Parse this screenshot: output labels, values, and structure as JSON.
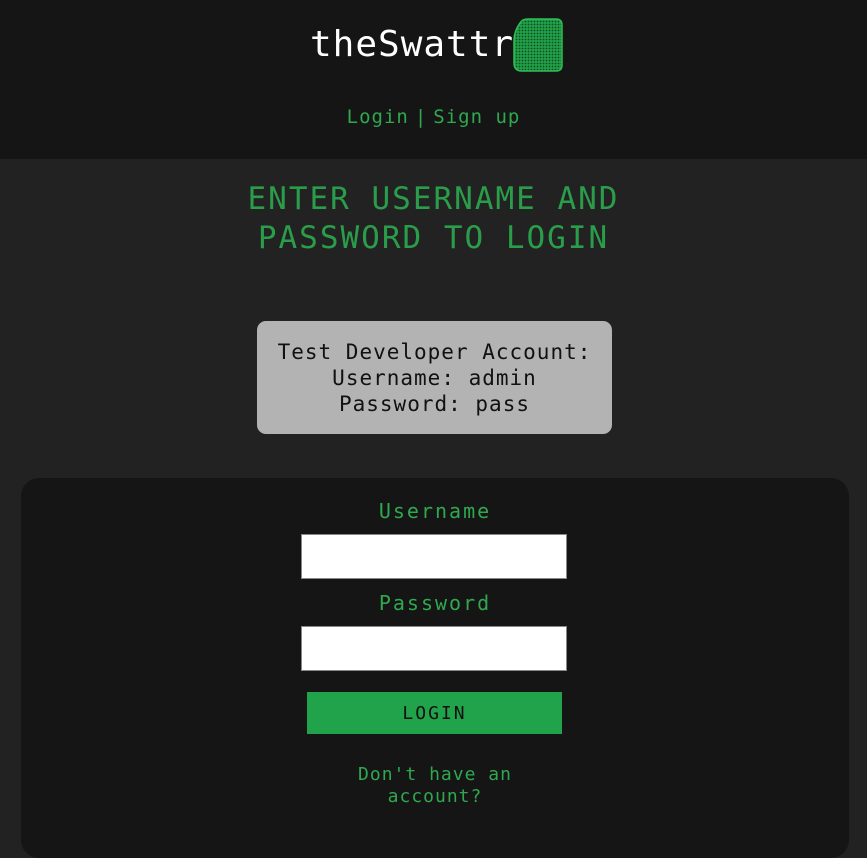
{
  "header": {
    "logo_text": "theSwattr",
    "logo_icon": "green-swatch-icon",
    "nav": {
      "login": "Login",
      "separator": "|",
      "signup": "Sign up"
    }
  },
  "main": {
    "heading_line1": "ENTER USERNAME AND",
    "heading_line2": "PASSWORD TO LOGIN",
    "test_account": {
      "title": "Test Developer Account:",
      "username_line": "Username: admin",
      "password_line": "Password: pass"
    },
    "form": {
      "username_label": "Username",
      "username_value": "",
      "password_label": "Password",
      "password_value": "",
      "submit_label": "LOGIN",
      "signup_prompt_line1": "Don't have an",
      "signup_prompt_line2": "account?"
    }
  },
  "colors": {
    "accent": "#2fa84f",
    "button": "#21a34b",
    "header_bg": "#151515",
    "page_bg": "#222222",
    "info_box_bg": "#b3b3b3"
  }
}
